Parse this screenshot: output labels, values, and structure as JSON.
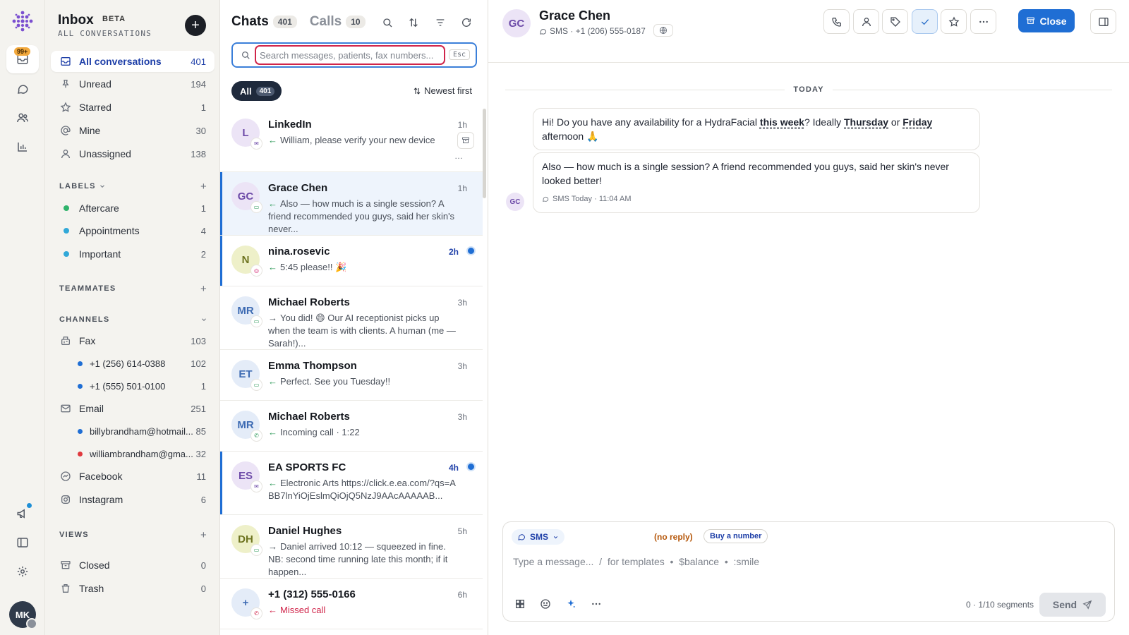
{
  "rail": {
    "badge": "99+",
    "avatar_initials": "MK"
  },
  "sidebar": {
    "title": "Inbox",
    "beta": "BETA",
    "subtitle": "ALL CONVERSATIONS",
    "add_label": "+",
    "items": [
      {
        "label": "All conversations",
        "count": "401",
        "icon": "inbox-icon"
      },
      {
        "label": "Unread",
        "count": "194",
        "icon": "pin-icon"
      },
      {
        "label": "Starred",
        "count": "1",
        "icon": "star-icon"
      },
      {
        "label": "Mine",
        "count": "30",
        "icon": "at-icon"
      },
      {
        "label": "Unassigned",
        "count": "138",
        "icon": "user-icon"
      }
    ],
    "labels_heading": "LABELS",
    "labels": [
      {
        "label": "Aftercare",
        "count": "1",
        "color": "#2fb36b"
      },
      {
        "label": "Appointments",
        "count": "4",
        "color": "#31a8d8"
      },
      {
        "label": "Important",
        "count": "2",
        "color": "#31a8d8"
      }
    ],
    "teammates_heading": "TEAMMATES",
    "channels_heading": "CHANNELS",
    "channels": {
      "fax": {
        "label": "Fax",
        "count": "103"
      },
      "fax_numbers": [
        {
          "label": "+1 (256) 614-0388",
          "count": "102",
          "color": "#1f6ed4"
        },
        {
          "label": "+1 (555) 501-0100",
          "count": "1",
          "color": "#1f6ed4"
        }
      ],
      "email": {
        "label": "Email",
        "count": "251"
      },
      "email_accounts": [
        {
          "label": "billybrandham@hotmail...",
          "count": "85",
          "color": "#1f6ed4"
        },
        {
          "label": "williambrandham@gma...",
          "count": "32",
          "color": "#e0393e"
        }
      ],
      "facebook": {
        "label": "Facebook",
        "count": "11"
      },
      "instagram": {
        "label": "Instagram",
        "count": "6"
      }
    },
    "views_heading": "VIEWS",
    "views": [
      {
        "label": "Closed",
        "count": "0"
      },
      {
        "label": "Trash",
        "count": "0"
      }
    ]
  },
  "list": {
    "tab_chats": "Chats",
    "tab_chats_count": "401",
    "tab_calls": "Calls",
    "tab_calls_count": "10",
    "search_placeholder": "Search messages, patients, fax numbers...",
    "esc": "Esc",
    "filter_all": "All",
    "filter_all_count": "401",
    "sort_label": "Newest first",
    "conversations": [
      {
        "initials": "L",
        "name": "LinkedIn",
        "time": "1h",
        "preview": "William, please verify your new device",
        "channel": "email",
        "direction": "in",
        "avatar_bg": "#ece4f6",
        "avatar_fg": "#6d4ba8"
      },
      {
        "initials": "GC",
        "name": "Grace Chen",
        "time": "1h",
        "preview": "Also — how much is a single session? A friend recommended you guys, said her skin's never...",
        "channel": "sms",
        "direction": "in",
        "avatar_bg": "#ece4f6",
        "avatar_fg": "#6d4ba8"
      },
      {
        "initials": "N",
        "name": "nina.rosevic",
        "time": "2h",
        "preview": "5:45 please!! 🎉",
        "channel": "instagram",
        "direction": "in",
        "avatar_bg": "#eef0c9",
        "avatar_fg": "#6e7420"
      },
      {
        "initials": "MR",
        "name": "Michael Roberts",
        "time": "3h",
        "preview": "You did! 😄 Our AI receptionist picks up when the team is with clients. A human (me — Sarah!)...",
        "channel": "sms",
        "direction": "out",
        "avatar_bg": "#e4ecf8",
        "avatar_fg": "#3d6bb3"
      },
      {
        "initials": "ET",
        "name": "Emma Thompson",
        "time": "3h",
        "preview": "Perfect. See you Tuesday!!",
        "channel": "sms",
        "direction": "in",
        "avatar_bg": "#e4ecf8",
        "avatar_fg": "#3d6bb3"
      },
      {
        "initials": "MR",
        "name": "Michael Roberts",
        "time": "3h",
        "preview": "Incoming call · 1:22",
        "channel": "phone",
        "direction": "in",
        "avatar_bg": "#e4ecf8",
        "avatar_fg": "#3d6bb3"
      },
      {
        "initials": "ES",
        "name": "EA SPORTS FC",
        "time": "4h",
        "preview": "Electronic Arts https://click.e.ea.com/?qs=ABB7lnYiOjEslmQiOjQ5NzJ9AAcAAAAAB...",
        "channel": "email",
        "direction": "in",
        "avatar_bg": "#ece4f6",
        "avatar_fg": "#6d4ba8"
      },
      {
        "initials": "DH",
        "name": "Daniel Hughes",
        "time": "5h",
        "preview": "Daniel arrived 10:12 — squeezed in fine. NB: second time running late this month; if it happen...",
        "channel": "sms",
        "direction": "out",
        "avatar_bg": "#eef0c9",
        "avatar_fg": "#6e7420"
      },
      {
        "initials": "+",
        "name": "+1 (312) 555-0166",
        "time": "6h",
        "preview": "Missed call",
        "channel": "missed",
        "direction": "in",
        "avatar_bg": "#e4ecf8",
        "avatar_fg": "#3d6bb3"
      }
    ]
  },
  "thread": {
    "initials": "GC",
    "name": "Grace Chen",
    "meta": "SMS · +1 (206) 555-0187",
    "close_label": "Close",
    "day_label": "TODAY",
    "msg1": {
      "p1": "Hi! Do you have any availability for a HydraFacial ",
      "u1": "this week",
      "p2": "? Ideally ",
      "u2": "Thursday",
      "p3": " or ",
      "u3": "Friday",
      "p4": " afternoon 🙏"
    },
    "msg2": "Also — how much is a single session? A friend recommended you guys, said her skin's never looked better!",
    "msg2_meta": "SMS  Today · 11:04 AM"
  },
  "composer": {
    "channel": "SMS",
    "no_reply": "(no reply)",
    "buy_number": "Buy a number",
    "placeholder": "Type a message...  /  for templates  •  $balance  •  :smile",
    "segments": "0 · 1/10 segments",
    "send": "Send"
  },
  "colors": {
    "accent": "#1f6ed4",
    "search_highlight": "#d0254a"
  }
}
